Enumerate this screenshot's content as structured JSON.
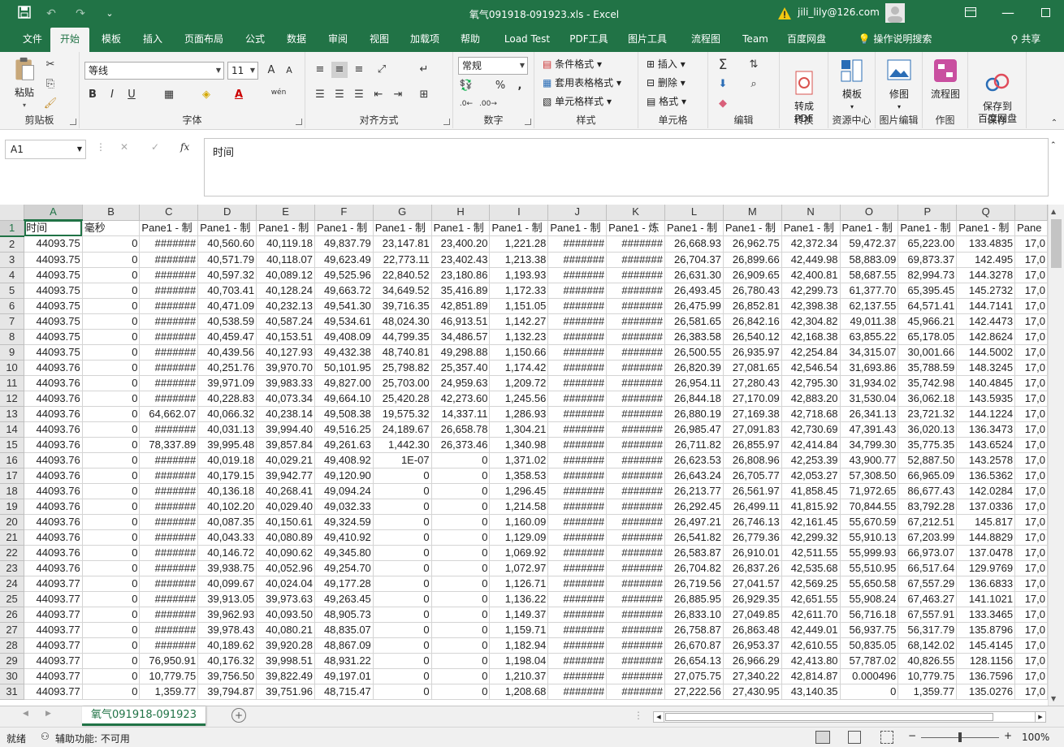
{
  "window": {
    "doc_title": "氧气091918-091923.xls  -  Excel",
    "user": "jili_lily@126.com",
    "warning_icon": "warning-icon",
    "share": "共享"
  },
  "tabs": [
    "文件",
    "开始",
    "模板",
    "插入",
    "页面布局",
    "公式",
    "数据",
    "审阅",
    "视图",
    "加载项",
    "帮助",
    "Load Test",
    "PDF工具",
    "图片工具",
    "流程图",
    "Team",
    "百度网盘"
  ],
  "tell_me": "操作说明搜索",
  "ribbon": {
    "paste": "粘贴",
    "clipboard": "剪贴板",
    "font_name": "等线",
    "font_size": "11",
    "font": "字体",
    "align": "对齐方式",
    "number_format": "常规",
    "number": "数字",
    "cond_format": "条件格式",
    "table_format": "套用表格格式",
    "cell_style": "单元格样式",
    "styles": "样式",
    "insert": "插入",
    "delete": "删除",
    "format": "格式",
    "cells": "单元格",
    "editing": "编辑",
    "to_pdf": "转成\nPDF",
    "convert": "转换",
    "templates": "模板",
    "resource_center": "资源中心",
    "fix_img": "修图",
    "img_edit": "图片编辑",
    "flowchart": "流程图",
    "draw": "作图",
    "save_baidu": "保存到\n百度网盘",
    "save": "保存",
    "wen": "wén",
    "percent": "%",
    "comma": ",",
    "fmt_bold": "B",
    "fmt_italic": "I",
    "fmt_underline": "U",
    "grow_font": "A",
    "shrink_font": "A",
    "font_color_glyph": "A"
  },
  "formula_bar": {
    "name_box": "A1",
    "content": "时间",
    "cancel": "✕",
    "enter": "✓",
    "fx": "fx"
  },
  "columns": [
    "A",
    "B",
    "C",
    "D",
    "E",
    "F",
    "G",
    "H",
    "I",
    "J",
    "K",
    "L",
    "M",
    "N",
    "O",
    "P",
    "Q",
    ""
  ],
  "rows": [
    [
      "时间",
      "毫秒",
      "Pane1 - 制",
      "Pane1 - 制",
      "Pane1 - 制",
      "Pane1 - 制",
      "Pane1 - 制",
      "Pane1 - 制",
      "Pane1 - 制",
      "Pane1 - 制",
      "Pane1 - 炼",
      "Pane1 - 制",
      "Pane1 - 制",
      "Pane1 - 制",
      "Pane1 - 制",
      "Pane1 - 制",
      "Pane1 - 制",
      "Pane"
    ],
    [
      "44093.75",
      "0",
      "#######",
      "40,560.60",
      "40,119.18",
      "49,837.79",
      "23,147.81",
      "23,400.20",
      "1,221.28",
      "#######",
      "#######",
      "26,668.93",
      "26,962.75",
      "42,372.34",
      "59,472.37",
      "65,223.00",
      "133.4835",
      "17,0"
    ],
    [
      "44093.75",
      "0",
      "#######",
      "40,571.79",
      "40,118.07",
      "49,623.49",
      "22,773.11",
      "23,402.43",
      "1,213.38",
      "#######",
      "#######",
      "26,704.37",
      "26,899.66",
      "42,449.98",
      "58,883.09",
      "69,873.37",
      "142.495",
      "17,0"
    ],
    [
      "44093.75",
      "0",
      "#######",
      "40,597.32",
      "40,089.12",
      "49,525.96",
      "22,840.52",
      "23,180.86",
      "1,193.93",
      "#######",
      "#######",
      "26,631.30",
      "26,909.65",
      "42,400.81",
      "58,687.55",
      "82,994.73",
      "144.3278",
      "17,0"
    ],
    [
      "44093.75",
      "0",
      "#######",
      "40,703.41",
      "40,128.24",
      "49,663.72",
      "34,649.52",
      "35,416.89",
      "1,172.33",
      "#######",
      "#######",
      "26,493.45",
      "26,780.43",
      "42,299.73",
      "61,377.70",
      "65,395.45",
      "145.2732",
      "17,0"
    ],
    [
      "44093.75",
      "0",
      "#######",
      "40,471.09",
      "40,232.13",
      "49,541.30",
      "39,716.35",
      "42,851.89",
      "1,151.05",
      "#######",
      "#######",
      "26,475.99",
      "26,852.81",
      "42,398.38",
      "62,137.55",
      "64,571.41",
      "144.7141",
      "17,0"
    ],
    [
      "44093.75",
      "0",
      "#######",
      "40,538.59",
      "40,587.24",
      "49,534.61",
      "48,024.30",
      "46,913.51",
      "1,142.27",
      "#######",
      "#######",
      "26,581.65",
      "26,842.16",
      "42,304.82",
      "49,011.38",
      "45,966.21",
      "142.4473",
      "17,0"
    ],
    [
      "44093.75",
      "0",
      "#######",
      "40,459.47",
      "40,153.51",
      "49,408.09",
      "44,799.35",
      "34,486.57",
      "1,132.23",
      "#######",
      "#######",
      "26,383.58",
      "26,540.12",
      "42,168.38",
      "63,855.22",
      "65,178.05",
      "142.8624",
      "17,0"
    ],
    [
      "44093.75",
      "0",
      "#######",
      "40,439.56",
      "40,127.93",
      "49,432.38",
      "48,740.81",
      "49,298.88",
      "1,150.66",
      "#######",
      "#######",
      "26,500.55",
      "26,935.97",
      "42,254.84",
      "34,315.07",
      "30,001.66",
      "144.5002",
      "17,0"
    ],
    [
      "44093.76",
      "0",
      "#######",
      "40,251.76",
      "39,970.70",
      "50,101.95",
      "25,798.82",
      "25,357.40",
      "1,174.42",
      "#######",
      "#######",
      "26,820.39",
      "27,081.65",
      "42,546.54",
      "31,693.86",
      "35,788.59",
      "148.3245",
      "17,0"
    ],
    [
      "44093.76",
      "0",
      "#######",
      "39,971.09",
      "39,983.33",
      "49,827.00",
      "25,703.00",
      "24,959.63",
      "1,209.72",
      "#######",
      "#######",
      "26,954.11",
      "27,280.43",
      "42,795.30",
      "31,934.02",
      "35,742.98",
      "140.4845",
      "17,0"
    ],
    [
      "44093.76",
      "0",
      "#######",
      "40,228.83",
      "40,073.34",
      "49,664.10",
      "25,420.28",
      "42,273.60",
      "1,245.56",
      "#######",
      "#######",
      "26,844.18",
      "27,170.09",
      "42,883.20",
      "31,530.04",
      "36,062.18",
      "143.5935",
      "17,0"
    ],
    [
      "44093.76",
      "0",
      "64,662.07",
      "40,066.32",
      "40,238.14",
      "49,508.38",
      "19,575.32",
      "14,337.11",
      "1,286.93",
      "#######",
      "#######",
      "26,880.19",
      "27,169.38",
      "42,718.68",
      "26,341.13",
      "23,721.32",
      "144.1224",
      "17,0"
    ],
    [
      "44093.76",
      "0",
      "#######",
      "40,031.13",
      "39,994.40",
      "49,516.25",
      "24,189.67",
      "26,658.78",
      "1,304.21",
      "#######",
      "#######",
      "26,985.47",
      "27,091.83",
      "42,730.69",
      "47,391.43",
      "36,020.13",
      "136.3473",
      "17,0"
    ],
    [
      "44093.76",
      "0",
      "78,337.89",
      "39,995.48",
      "39,857.84",
      "49,261.63",
      "1,442.30",
      "26,373.46",
      "1,340.98",
      "#######",
      "#######",
      "26,711.82",
      "26,855.97",
      "42,414.84",
      "34,799.30",
      "35,775.35",
      "143.6524",
      "17,0"
    ],
    [
      "44093.76",
      "0",
      "#######",
      "40,019.18",
      "40,029.21",
      "49,408.92",
      "1E-07",
      "0",
      "1,371.02",
      "#######",
      "#######",
      "26,623.53",
      "26,808.96",
      "42,253.39",
      "43,900.77",
      "52,887.50",
      "143.2578",
      "17,0"
    ],
    [
      "44093.76",
      "0",
      "#######",
      "40,179.15",
      "39,942.77",
      "49,120.90",
      "0",
      "0",
      "1,358.53",
      "#######",
      "#######",
      "26,643.24",
      "26,705.77",
      "42,053.27",
      "57,308.50",
      "66,965.09",
      "136.5362",
      "17,0"
    ],
    [
      "44093.76",
      "0",
      "#######",
      "40,136.18",
      "40,268.41",
      "49,094.24",
      "0",
      "0",
      "1,296.45",
      "#######",
      "#######",
      "26,213.77",
      "26,561.97",
      "41,858.45",
      "71,972.65",
      "86,677.43",
      "142.0284",
      "17,0"
    ],
    [
      "44093.76",
      "0",
      "#######",
      "40,102.20",
      "40,029.40",
      "49,032.33",
      "0",
      "0",
      "1,214.58",
      "#######",
      "#######",
      "26,292.45",
      "26,499.11",
      "41,815.92",
      "70,844.55",
      "83,792.28",
      "137.0336",
      "17,0"
    ],
    [
      "44093.76",
      "0",
      "#######",
      "40,087.35",
      "40,150.61",
      "49,324.59",
      "0",
      "0",
      "1,160.09",
      "#######",
      "#######",
      "26,497.21",
      "26,746.13",
      "42,161.45",
      "55,670.59",
      "67,212.51",
      "145.817",
      "17,0"
    ],
    [
      "44093.76",
      "0",
      "#######",
      "40,043.33",
      "40,080.89",
      "49,410.92",
      "0",
      "0",
      "1,129.09",
      "#######",
      "#######",
      "26,541.82",
      "26,779.36",
      "42,299.32",
      "55,910.13",
      "67,203.99",
      "144.8829",
      "17,0"
    ],
    [
      "44093.76",
      "0",
      "#######",
      "40,146.72",
      "40,090.62",
      "49,345.80",
      "0",
      "0",
      "1,069.92",
      "#######",
      "#######",
      "26,583.87",
      "26,910.01",
      "42,511.55",
      "55,999.93",
      "66,973.07",
      "137.0478",
      "17,0"
    ],
    [
      "44093.76",
      "0",
      "#######",
      "39,938.75",
      "40,052.96",
      "49,254.70",
      "0",
      "0",
      "1,072.97",
      "#######",
      "#######",
      "26,704.82",
      "26,837.26",
      "42,535.68",
      "55,510.95",
      "66,517.64",
      "129.9769",
      "17,0"
    ],
    [
      "44093.77",
      "0",
      "#######",
      "40,099.67",
      "40,024.04",
      "49,177.28",
      "0",
      "0",
      "1,126.71",
      "#######",
      "#######",
      "26,719.56",
      "27,041.57",
      "42,569.25",
      "55,650.58",
      "67,557.29",
      "136.6833",
      "17,0"
    ],
    [
      "44093.77",
      "0",
      "#######",
      "39,913.05",
      "39,973.63",
      "49,263.45",
      "0",
      "0",
      "1,136.22",
      "#######",
      "#######",
      "26,885.95",
      "26,929.35",
      "42,651.55",
      "55,908.24",
      "67,463.27",
      "141.1021",
      "17,0"
    ],
    [
      "44093.77",
      "0",
      "#######",
      "39,962.93",
      "40,093.50",
      "48,905.73",
      "0",
      "0",
      "1,149.37",
      "#######",
      "#######",
      "26,833.10",
      "27,049.85",
      "42,611.70",
      "56,716.18",
      "67,557.91",
      "133.3465",
      "17,0"
    ],
    [
      "44093.77",
      "0",
      "#######",
      "39,978.43",
      "40,080.21",
      "48,835.07",
      "0",
      "0",
      "1,159.71",
      "#######",
      "#######",
      "26,758.87",
      "26,863.48",
      "42,449.01",
      "56,937.75",
      "56,317.79",
      "135.8796",
      "17,0"
    ],
    [
      "44093.77",
      "0",
      "#######",
      "40,189.62",
      "39,920.28",
      "48,867.09",
      "0",
      "0",
      "1,182.94",
      "#######",
      "#######",
      "26,670.87",
      "26,953.37",
      "42,610.55",
      "50,835.05",
      "68,142.02",
      "145.4145",
      "17,0"
    ],
    [
      "44093.77",
      "0",
      "76,950.91",
      "40,176.32",
      "39,998.51",
      "48,931.22",
      "0",
      "0",
      "1,198.04",
      "#######",
      "#######",
      "26,654.13",
      "26,966.29",
      "42,413.80",
      "57,787.02",
      "40,826.55",
      "128.1156",
      "17,0"
    ],
    [
      "44093.77",
      "0",
      "10,779.75",
      "39,756.50",
      "39,822.49",
      "49,197.01",
      "0",
      "0",
      "1,210.37",
      "#######",
      "#######",
      "27,075.75",
      "27,340.22",
      "42,814.87",
      "0.000496",
      "10,779.75",
      "136.7596",
      "17,0"
    ],
    [
      "44093.77",
      "0",
      "1,359.77",
      "39,794.87",
      "39,751.96",
      "48,715.47",
      "0",
      "0",
      "1,208.68",
      "#######",
      "#######",
      "27,222.56",
      "27,430.95",
      "43,140.35",
      "0",
      "1,359.77",
      "135.0276",
      "17,0"
    ]
  ],
  "sheet_tab": "氧气091918-091923",
  "status": {
    "ready": "就绪",
    "accessibility": "辅助功能: 不可用",
    "zoom": "100%"
  }
}
